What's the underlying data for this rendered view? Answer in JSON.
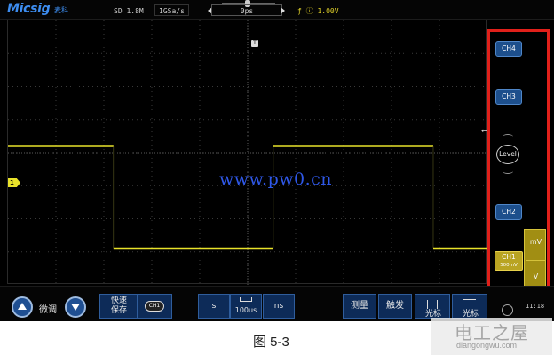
{
  "top_bar": {
    "brand": "Micsig",
    "brand_sub": "麦科",
    "memory_depth": "SD 1.8M",
    "sample_rate": "1GSa/s",
    "time_position": "0ps",
    "trigger_info": "1.00V"
  },
  "screen": {
    "watermark": "www.pw0.cn",
    "channel_marker": "1",
    "trigger_marker": "T",
    "level_mark": "←"
  },
  "side_panel": {
    "ch4_label": "CH4",
    "ch3_label": "CH3",
    "level_label": "Level",
    "ch2_label": "CH2",
    "ch1_label": "CH1",
    "ch1_scale": "500mV",
    "unit_mv": "mV",
    "unit_v": "V",
    "highlight_color": "#e0201a"
  },
  "bottom_bar": {
    "fine_label": "微调",
    "quick_save_line1": "快速",
    "quick_save_line2": "保存",
    "ch1_pill": "CH1",
    "unit_s": "s",
    "timebase": "100us",
    "unit_ns": "ns",
    "measure_label": "测量",
    "trigger_label": "触发",
    "cursor1_label": "光标",
    "cursor2_label": "光标",
    "clock": "11:18"
  },
  "caption": "图 5-3",
  "site": {
    "name": "电工之屋",
    "url": "diangongwu.com"
  },
  "colors": {
    "trace": "#e8e22a",
    "accent": "#1d4f8c",
    "watermark": "#2f58e8"
  },
  "waveform": {
    "period_divisions": 6.67,
    "high_level_div": 4.2,
    "low_level_div": 1.1
  }
}
